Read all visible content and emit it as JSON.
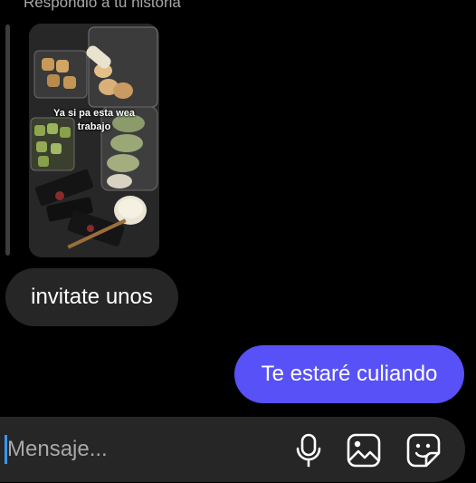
{
  "thread": {
    "reply_header": "Respondió a tu historia",
    "story": {
      "caption": "Ya si pa esta wea trabajo"
    },
    "messages": [
      {
        "direction": "received",
        "text": "invitate unos"
      },
      {
        "direction": "sent",
        "text": "Te estaré culiando"
      }
    ]
  },
  "composer": {
    "placeholder": "Mensaje...",
    "value": "",
    "icons": [
      "microphone-icon",
      "gallery-icon",
      "sticker-icon"
    ]
  },
  "colors": {
    "background": "#000000",
    "received_bubble": "#262626",
    "sent_bubble": "#5851f7",
    "composer": "#262626",
    "caret": "#3897f0"
  }
}
